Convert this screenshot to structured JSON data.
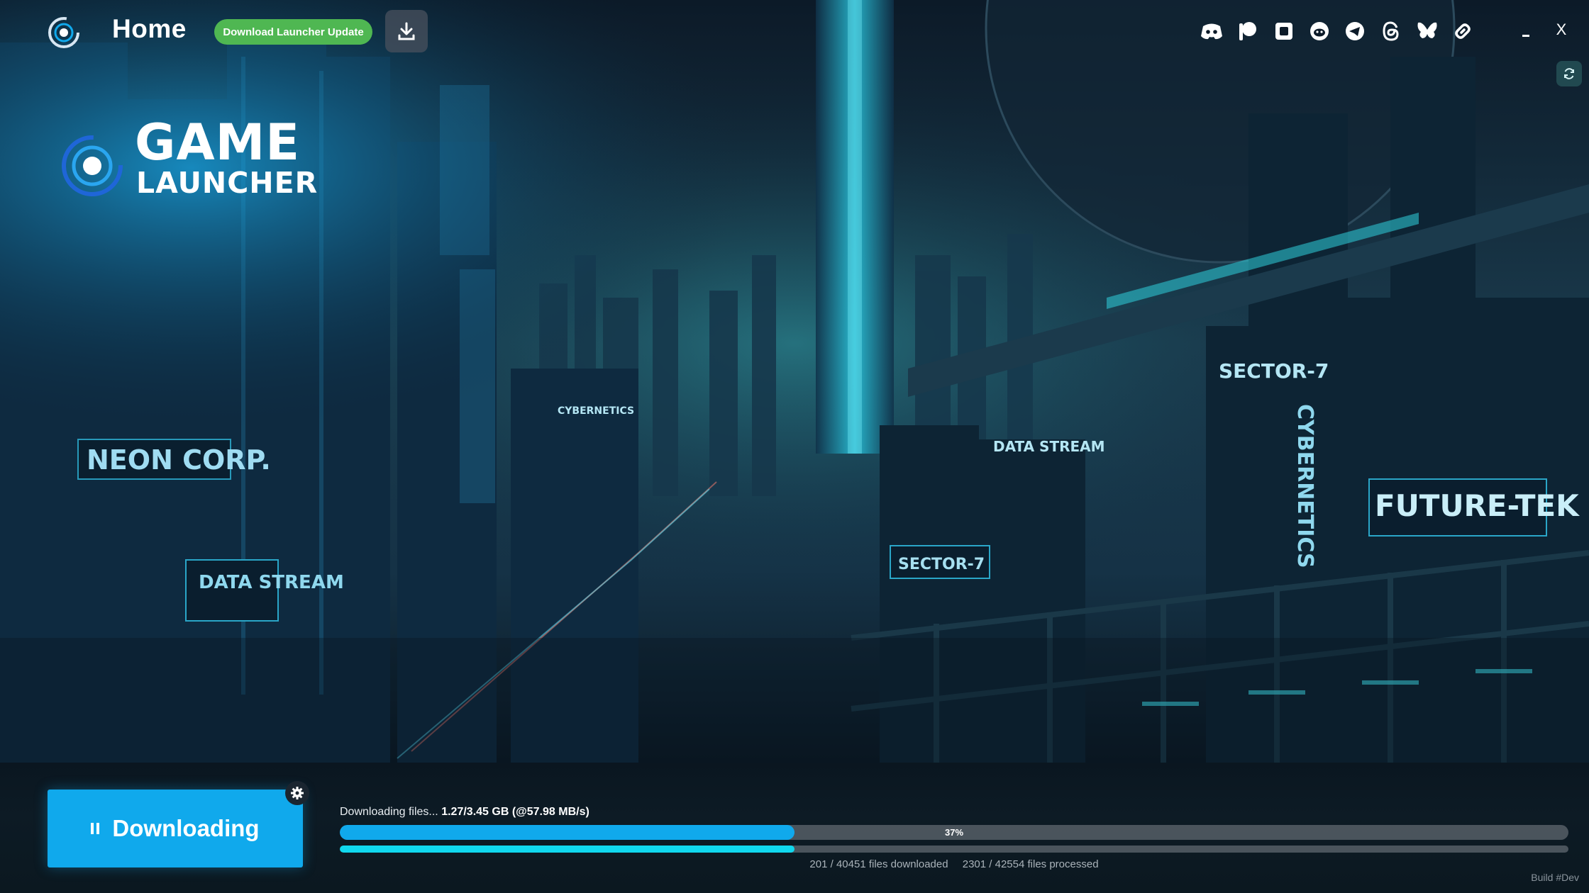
{
  "header": {
    "title": "Home",
    "update_button_label": "Download Launcher Update",
    "icons": {
      "app_logo": "orbit-logo-icon",
      "download": "download-icon",
      "minimize": "minimize-icon",
      "close": "X",
      "refresh": "refresh-icon"
    },
    "social_links": [
      "discord-icon",
      "patreon-icon",
      "kofi-icon",
      "reddit-icon",
      "telegram-icon",
      "threads-icon",
      "bluesky-icon",
      "link-icon"
    ]
  },
  "game_logo": {
    "line1": "GAME",
    "line2": "LAUNCHER"
  },
  "background": {
    "signs": [
      "NEON CORP.",
      "DATA STREAM",
      "SECTOR-7",
      "FUTURE-TEK",
      "CYBERNETICS",
      "DATA STREAM",
      "SECTOR-7",
      "CYBERNETICS"
    ]
  },
  "download": {
    "button_label": "Downloading",
    "status_prefix": "Downloading files...",
    "status_detail": "1.27/3.45 GB (@57.98 MB/s)",
    "progress_percent_label": "37%",
    "progress_fraction": 0.37,
    "files_progress_fraction": 0.37,
    "files_downloaded": "201 / 40451 files downloaded",
    "files_processed": "2301 / 42554 files processed"
  },
  "footer": {
    "build": "Build #Dev"
  },
  "colors": {
    "accent": "#10a9ec",
    "progress_secondary": "#10d8ee",
    "update_button": "#4fb752"
  }
}
